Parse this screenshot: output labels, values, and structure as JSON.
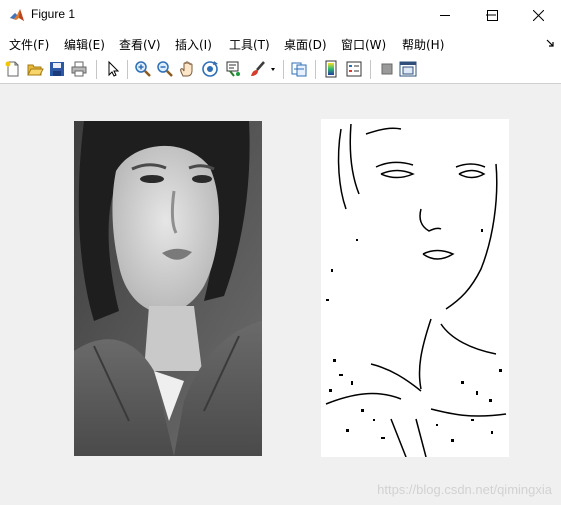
{
  "window": {
    "title": "Figure 1"
  },
  "menu": [
    {
      "label": "文件(F)"
    },
    {
      "label": "编辑(E)"
    },
    {
      "label": "查看(V)"
    },
    {
      "label": "插入(I)"
    },
    {
      "label": "工具(T)"
    },
    {
      "label": "桌面(D)"
    },
    {
      "label": "窗口(W)"
    },
    {
      "label": "帮助(H)"
    }
  ],
  "toolbar": {
    "icons": [
      "new-figure-icon",
      "open-file-icon",
      "save-icon",
      "print-icon",
      "edit-plot-arrow-icon",
      "zoom-in-icon",
      "zoom-out-icon",
      "pan-hand-icon",
      "rotate-3d-icon",
      "data-cursor-icon",
      "brush-icon",
      "link-plot-icon",
      "colorbar-icon",
      "legend-icon",
      "hide-plot-tools-icon",
      "show-plot-tools-icon"
    ]
  },
  "images": {
    "left": {
      "kind": "grayscale-photo",
      "colors": {
        "bg": "#5c5c5c"
      }
    },
    "right": {
      "kind": "binary-edge-map",
      "colors": {
        "bg": "#ffffff",
        "edges": "#000000"
      }
    }
  },
  "watermark": {
    "text": "https://blog.csdn.net/qimingxia"
  }
}
